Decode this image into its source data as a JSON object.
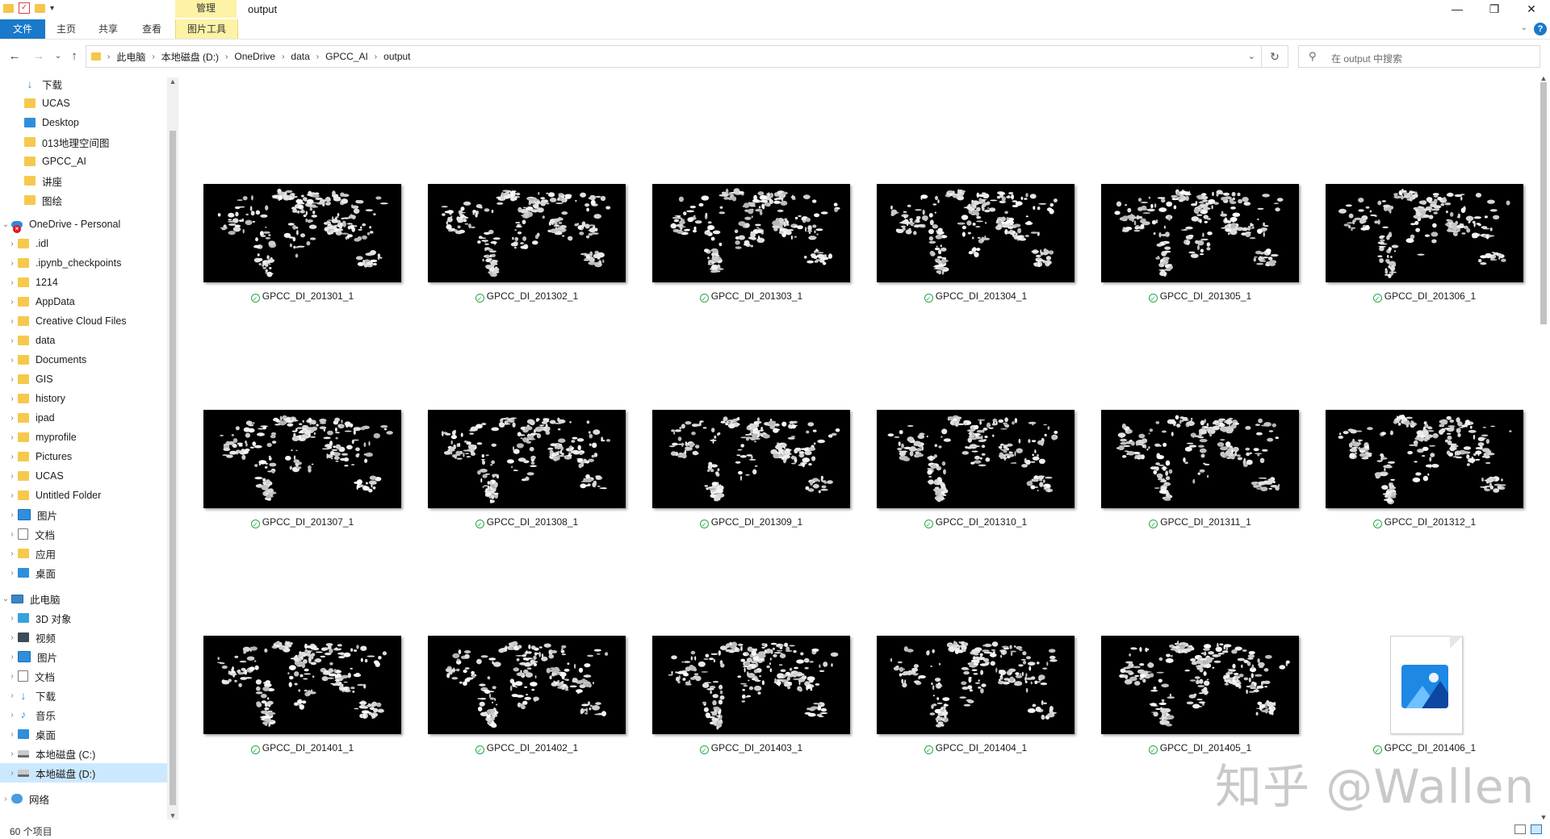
{
  "window": {
    "title": "output",
    "context_tab_header": "管理",
    "controls": {
      "minimize": "—",
      "maximize": "❐",
      "close": "✕"
    }
  },
  "ribbon": {
    "tabs": [
      "文件",
      "主页",
      "共享",
      "查看",
      "图片工具"
    ]
  },
  "address": {
    "crumbs": [
      "此电脑",
      "本地磁盘 (D:)",
      "OneDrive",
      "data",
      "GPCC_AI",
      "output"
    ]
  },
  "search": {
    "placeholder": "在 output 中搜索"
  },
  "nav": {
    "quick_access": [
      {
        "label": "下载",
        "icon": "download-icon",
        "pinned": true
      },
      {
        "label": "UCAS",
        "icon": "folder-icon",
        "pinned": true
      },
      {
        "label": "Desktop",
        "icon": "desktop-folder-icon",
        "pinned": true
      },
      {
        "label": "013地理空间图",
        "icon": "folder-icon"
      },
      {
        "label": "GPCC_AI",
        "icon": "folder-icon"
      },
      {
        "label": "讲座",
        "icon": "folder-icon"
      },
      {
        "label": "图绘",
        "icon": "folder-icon"
      }
    ],
    "onedrive": {
      "label": "OneDrive - Personal",
      "children": [
        ".idl",
        ".ipynb_checkpoints",
        "1214",
        "AppData",
        "Creative Cloud Files",
        "data",
        "Documents",
        "GIS",
        "history",
        "ipad",
        "myprofile",
        "Pictures",
        "UCAS",
        "Untitled Folder",
        "图片",
        "文档",
        "应用",
        "桌面"
      ]
    },
    "this_pc": {
      "label": "此电脑",
      "children": [
        {
          "label": "3D 对象",
          "icon": "3d-objects-icon"
        },
        {
          "label": "视频",
          "icon": "video-icon"
        },
        {
          "label": "图片",
          "icon": "pictures-icon"
        },
        {
          "label": "文档",
          "icon": "documents-icon"
        },
        {
          "label": "下载",
          "icon": "download-icon"
        },
        {
          "label": "音乐",
          "icon": "music-icon"
        },
        {
          "label": "桌面",
          "icon": "desktop-icon"
        },
        {
          "label": "本地磁盘 (C:)",
          "icon": "drive-icon"
        },
        {
          "label": "本地磁盘 (D:)",
          "icon": "drive-icon",
          "selected": true
        }
      ]
    },
    "network": {
      "label": "网络"
    }
  },
  "files": [
    {
      "name": "GPCC_DI_201301_1"
    },
    {
      "name": "GPCC_DI_201302_1"
    },
    {
      "name": "GPCC_DI_201303_1"
    },
    {
      "name": "GPCC_DI_201304_1"
    },
    {
      "name": "GPCC_DI_201305_1"
    },
    {
      "name": "GPCC_DI_201306_1"
    },
    {
      "name": "GPCC_DI_201307_1"
    },
    {
      "name": "GPCC_DI_201308_1"
    },
    {
      "name": "GPCC_DI_201309_1"
    },
    {
      "name": "GPCC_DI_201310_1"
    },
    {
      "name": "GPCC_DI_201311_1"
    },
    {
      "name": "GPCC_DI_201312_1"
    },
    {
      "name": "GPCC_DI_201401_1"
    },
    {
      "name": "GPCC_DI_201402_1"
    },
    {
      "name": "GPCC_DI_201403_1"
    },
    {
      "name": "GPCC_DI_201404_1"
    },
    {
      "name": "GPCC_DI_201405_1"
    },
    {
      "name": "GPCC_DI_201406_1",
      "generic_icon": true
    }
  ],
  "status": {
    "item_count": "60 个项目"
  },
  "watermark": "知乎 @Wallen",
  "colors": {
    "accent": "#1979ca",
    "context_tab": "#fdf2a6",
    "selected": "#cce8ff",
    "sync_ok": "#28a745"
  }
}
